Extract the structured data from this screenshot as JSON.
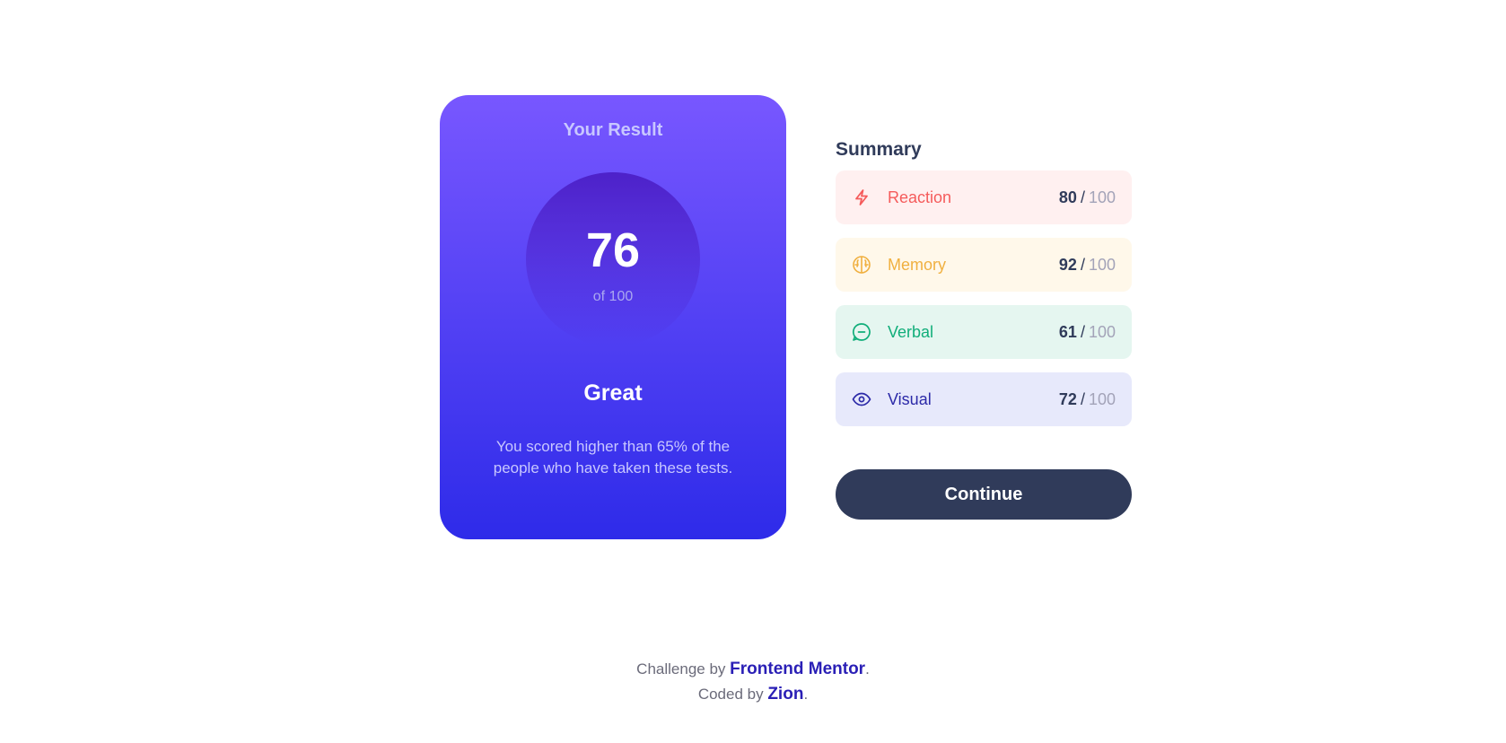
{
  "result": {
    "heading": "Your Result",
    "score": "76",
    "total": "of 100",
    "rating": "Great",
    "description": "You scored higher than 65% of the people who have taken these tests."
  },
  "summary": {
    "title": "Summary",
    "items": [
      {
        "label": "Reaction",
        "score": "80",
        "slash": "/",
        "max": "100",
        "icon": "lightning-icon",
        "color": "#f55b5b",
        "bg": "#fff0f0"
      },
      {
        "label": "Memory",
        "score": "92",
        "slash": "/",
        "max": "100",
        "icon": "brain-icon",
        "color": "#f0b040",
        "bg": "#fff8ea"
      },
      {
        "label": "Verbal",
        "score": "61",
        "slash": "/",
        "max": "100",
        "icon": "speech-bubble-icon",
        "color": "#11ae7a",
        "bg": "#e5f6f0"
      },
      {
        "label": "Visual",
        "score": "72",
        "slash": "/",
        "max": "100",
        "icon": "eye-icon",
        "color": "#2c2aa8",
        "bg": "#e7e9fb"
      }
    ],
    "continue_label": "Continue"
  },
  "footer": {
    "challenge_prefix": "Challenge by",
    "challenge_link": "Frontend Mentor",
    "coded_prefix": "Coded by",
    "coded_link": "Zion",
    "period": "."
  }
}
